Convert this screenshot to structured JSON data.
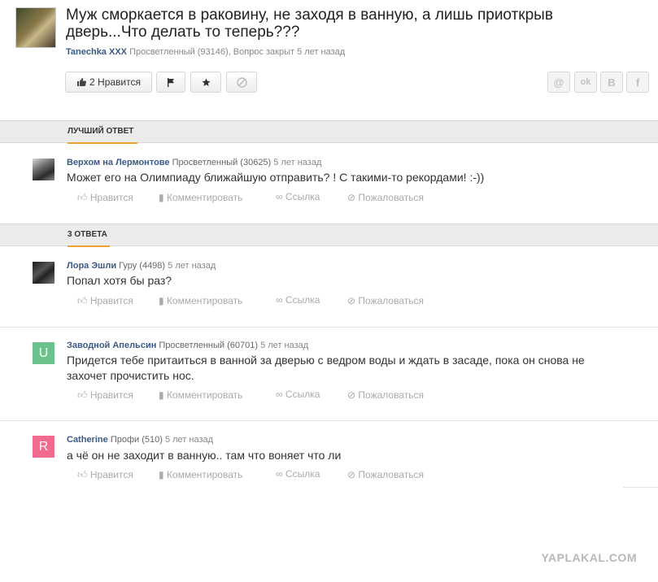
{
  "question": {
    "title": "Муж сморкается в раковину, не заходя в ванную, а лишь приоткрыв дверь...Что делать то теперь???",
    "author": "Tanechka XXX",
    "meta": "Просветленный (93146), Вопрос закрыт 5 лет назад"
  },
  "toolbar": {
    "like_label": "2 Нравится"
  },
  "share": [
    "@",
    "ok",
    "В",
    "f"
  ],
  "best_section": "ЛУЧШИЙ ОТВЕТ",
  "answers_section": "3 ОТВЕТА",
  "actions": {
    "like": "Нравится",
    "comment": "Комментировать",
    "link": "Ссылка",
    "report": "Пожаловаться"
  },
  "best_answer": {
    "author": "Верхом на Лермонтове",
    "rank": "Просветленный (30625)",
    "time": "5 лет назад",
    "text": "Может его на Олимпиаду ближайшую отправить? ! С такими-то рекордами! :-))"
  },
  "answers": [
    {
      "author": "Лора Эшли",
      "rank": "Гуру (4498)",
      "time": "5 лет назад",
      "text": "Попал хотя бы раз?",
      "avatar_letter": "",
      "avatar_color": ""
    },
    {
      "author": "Заводной Апельсин",
      "rank": "Просветленный (60701)",
      "time": "5 лет назад",
      "text": "Придется тебе притаиться в ванной за дверью с ведром воды и ждать в засаде, пока он снова не захочет прочистить нос.",
      "avatar_letter": "U",
      "avatar_color": "#6cc28c"
    },
    {
      "author": "Catherine",
      "rank": "Профи (510)",
      "time": "5 лет назад",
      "text": "а чё он не заходит в ванную.. там что воняет что ли",
      "avatar_letter": "R",
      "avatar_color": "#f06b8e"
    }
  ],
  "watermark": "YAPLAKAL.COM",
  "colors": {
    "author_link": "#3b5a86",
    "section_accent": "#f0a030"
  }
}
